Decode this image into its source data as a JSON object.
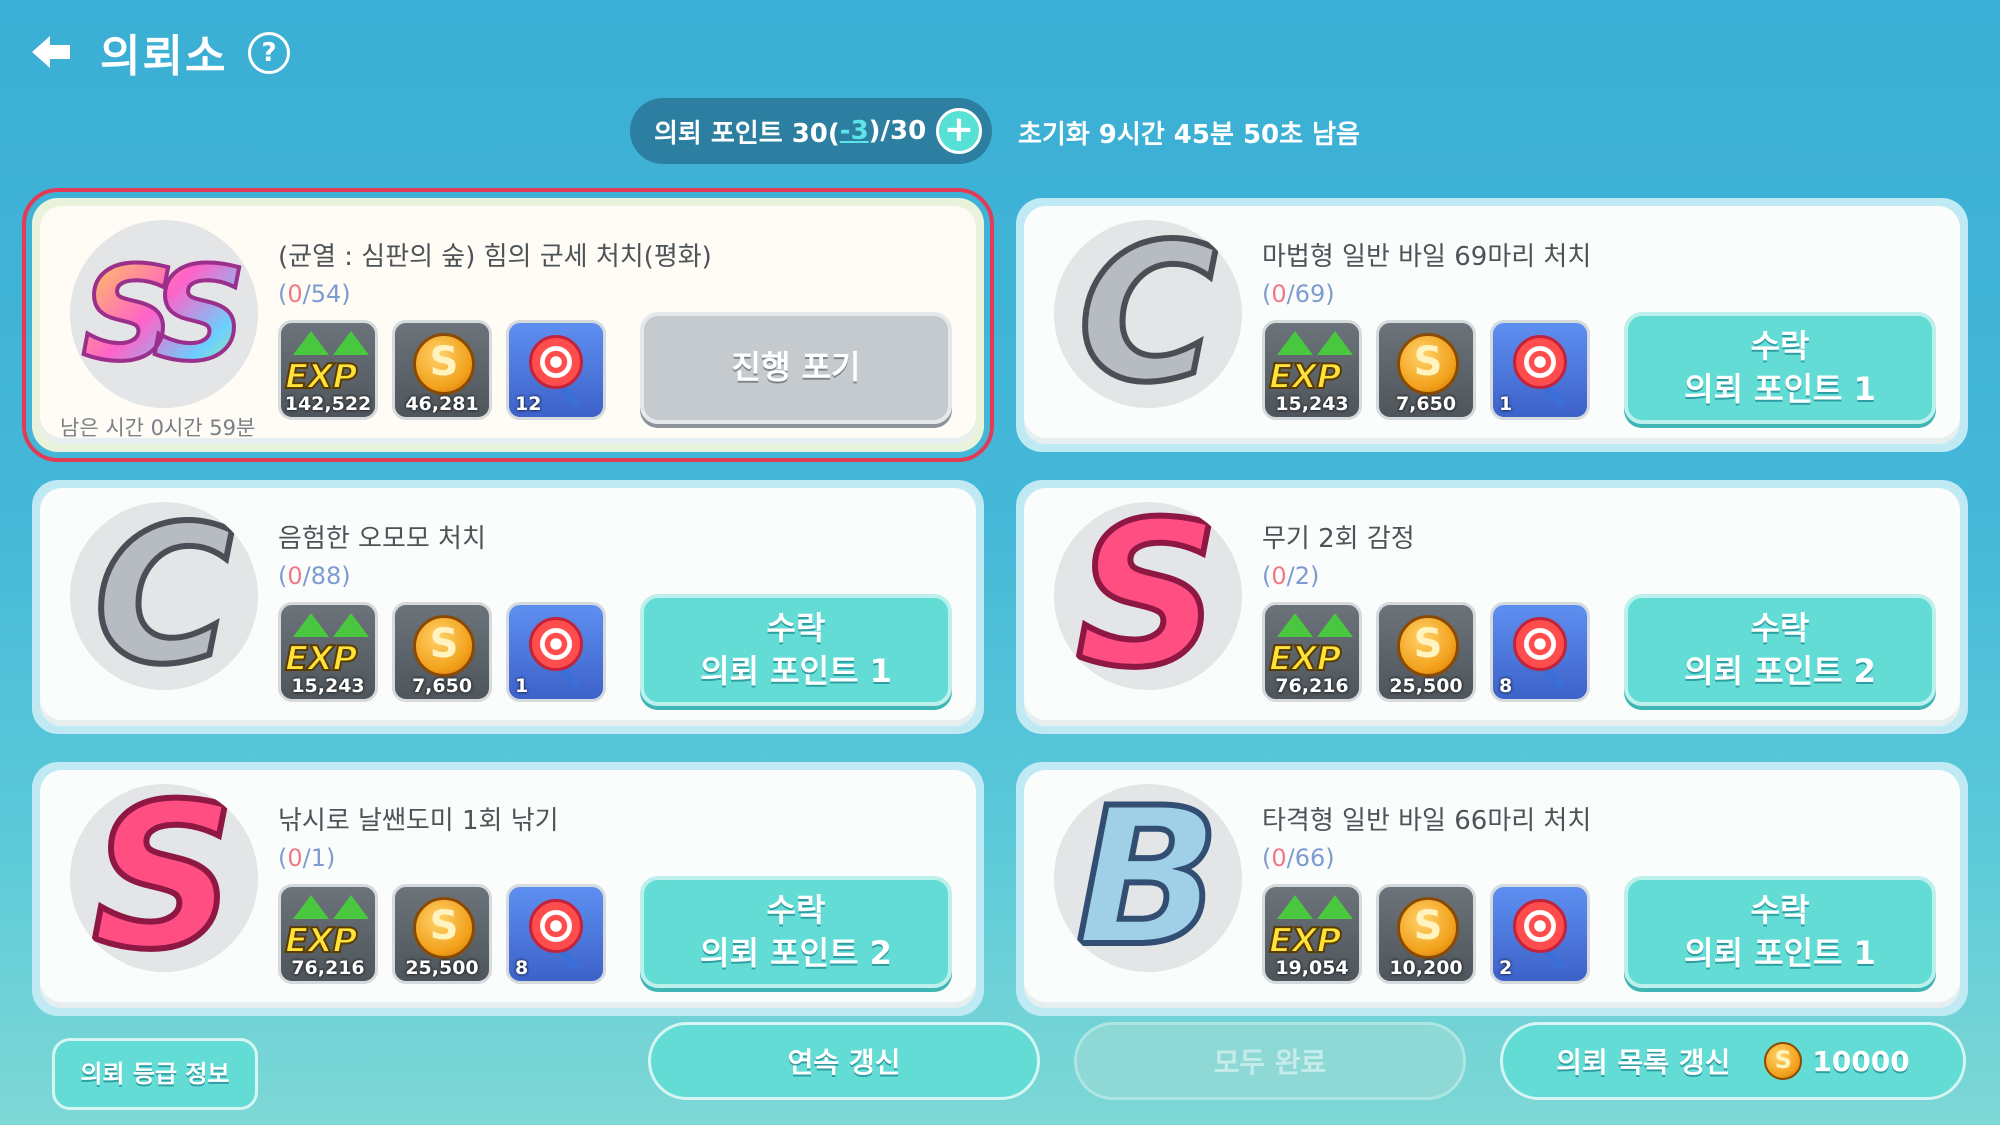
{
  "header": {
    "title": "의뢰소",
    "help_glyph": "?"
  },
  "points": {
    "label_prefix": "의뢰 포인트 30(",
    "minus": "-3",
    "label_suffix": ")/30",
    "plus_glyph": "+",
    "reset_text": "초기화 9시간 45분 50초 남음"
  },
  "quests": [
    {
      "grade": "SS",
      "name": "(균열 : 심판의 숲) 힘의 군세 처치(평화)",
      "current": "0",
      "target": "/54)",
      "remain": "남은 시간 0시간 59분",
      "exp": "142,522",
      "gold": "46,281",
      "item": "12",
      "btn_line1": "진행 포기",
      "btn_line2": ""
    },
    {
      "grade": "C",
      "name": "마법형 일반 바일 69마리 처치",
      "current": "0",
      "target": "/69)",
      "remain": "",
      "exp": "15,243",
      "gold": "7,650",
      "item": "1",
      "btn_line1": "수락",
      "btn_line2": "의뢰 포인트 1"
    },
    {
      "grade": "C",
      "name": "음험한 오모모 처치",
      "current": "0",
      "target": "/88)",
      "remain": "",
      "exp": "15,243",
      "gold": "7,650",
      "item": "1",
      "btn_line1": "수락",
      "btn_line2": "의뢰 포인트 1"
    },
    {
      "grade": "S",
      "name": "무기 2회 감정",
      "current": "0",
      "target": "/2)",
      "remain": "",
      "exp": "76,216",
      "gold": "25,500",
      "item": "8",
      "btn_line1": "수락",
      "btn_line2": "의뢰 포인트 2"
    },
    {
      "grade": "S",
      "name": "낚시로 날쌘도미 1회 낚기",
      "current": "0",
      "target": "/1)",
      "remain": "",
      "exp": "76,216",
      "gold": "25,500",
      "item": "8",
      "btn_line1": "수락",
      "btn_line2": "의뢰 포인트 2"
    },
    {
      "grade": "B",
      "name": "타격형 일반 바일 66마리 처치",
      "current": "0",
      "target": "/66)",
      "remain": "",
      "exp": "19,054",
      "gold": "10,200",
      "item": "2",
      "btn_line1": "수락",
      "btn_line2": "의뢰 포인트 1"
    }
  ],
  "reward_labels": {
    "exp": "EXP",
    "gold_glyph": "S"
  },
  "footer": {
    "grade_info": "의뢰 등급 정보",
    "continuous": "연속 갱신",
    "complete_all": "모두 완료",
    "refresh_list": "의뢰 목록 갱신",
    "refresh_cost": "10000"
  },
  "colors": {
    "accent": "#63dcd6",
    "selected_outline": "#e23b55",
    "progress_current": "#f07a8a"
  }
}
